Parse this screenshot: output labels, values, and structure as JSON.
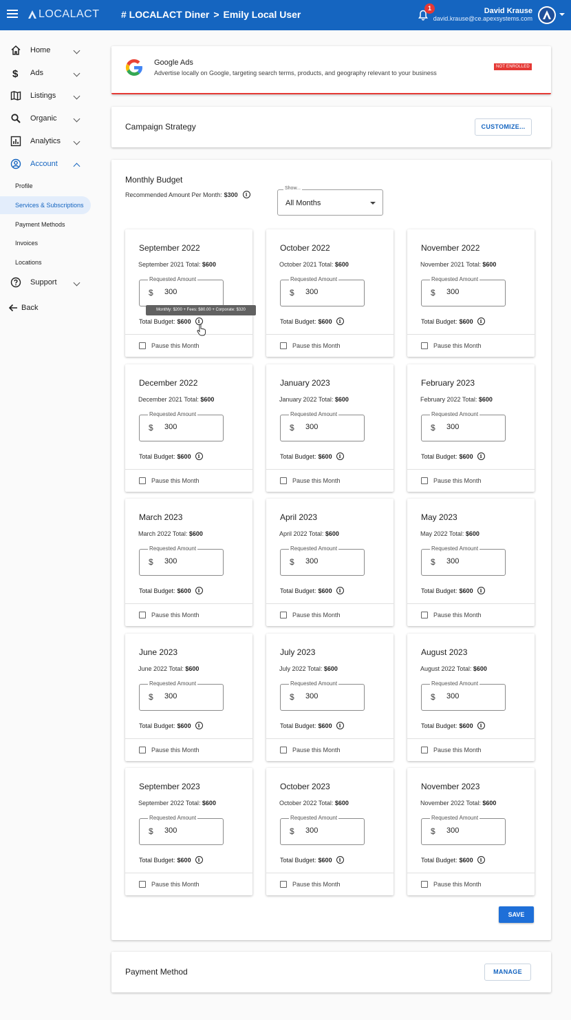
{
  "header": {
    "app_name": "LOCALACT",
    "breadcrumb_store": "# LOCALACT Diner",
    "breadcrumb_sep": ">",
    "breadcrumb_user": "Emily Local User",
    "notification_count": "1",
    "user_name": "David Krause",
    "user_email": "david.krause@ce.apexsystems.com"
  },
  "sidebar": {
    "items": [
      {
        "label": "Home",
        "icon": "home-icon"
      },
      {
        "label": "Ads",
        "icon": "dollar-icon"
      },
      {
        "label": "Listings",
        "icon": "map-icon"
      },
      {
        "label": "Organic",
        "icon": "search-icon"
      },
      {
        "label": "Analytics",
        "icon": "analytics-icon"
      },
      {
        "label": "Account",
        "icon": "account-icon"
      }
    ],
    "subitems": [
      "Profile",
      "Services & Subscriptions",
      "Payment Methods",
      "Invoices",
      "Locations"
    ],
    "support": "Support",
    "back": "Back"
  },
  "google_ads": {
    "title": "Google Ads",
    "description": "Advertise locally on Google, targeting search terms, products, and geography relevant to your business",
    "status": "NOT ENROLLED"
  },
  "campaign": {
    "title": "Campaign Strategy",
    "button": "CUSTOMIZE..."
  },
  "budget": {
    "title": "Monthly Budget",
    "recommended_label": "Recommended Amount Per Month:",
    "recommended_value": "$300",
    "show_label": "Show...",
    "show_value": "All Months",
    "field_label": "Requested Amount",
    "currency": "$",
    "total_label": "Total Budget:",
    "pause_label": "Pause this Month",
    "tooltip": "Monthly: $200 + Fees: $80.00 + Corporate: $320",
    "save_label": "SAVE",
    "months": [
      {
        "title": "September 2022",
        "prev_label": "September 2021 Total:",
        "prev_value": "$600",
        "amount": "300",
        "total": "$600"
      },
      {
        "title": "October 2022",
        "prev_label": "October 2021 Total:",
        "prev_value": "$600",
        "amount": "300",
        "total": "$600"
      },
      {
        "title": "November 2022",
        "prev_label": "November 2021 Total:",
        "prev_value": "$600",
        "amount": "300",
        "total": "$600"
      },
      {
        "title": "December 2022",
        "prev_label": "December 2021 Total:",
        "prev_value": "$600",
        "amount": "300",
        "total": "$600"
      },
      {
        "title": "January 2023",
        "prev_label": "January 2022 Total:",
        "prev_value": "$600",
        "amount": "300",
        "total": "$600"
      },
      {
        "title": "February 2023",
        "prev_label": "February 2022 Total:",
        "prev_value": "$600",
        "amount": "300",
        "total": "$600"
      },
      {
        "title": "March 2023",
        "prev_label": "March 2022 Total:",
        "prev_value": "$600",
        "amount": "300",
        "total": "$600"
      },
      {
        "title": "April 2023",
        "prev_label": "April 2022 Total:",
        "prev_value": "$600",
        "amount": "300",
        "total": "$600"
      },
      {
        "title": "May 2023",
        "prev_label": "May 2022 Total:",
        "prev_value": "$600",
        "amount": "300",
        "total": "$600"
      },
      {
        "title": "June 2023",
        "prev_label": "June 2022 Total:",
        "prev_value": "$600",
        "amount": "300",
        "total": "$600"
      },
      {
        "title": "July 2023",
        "prev_label": "July 2022 Total:",
        "prev_value": "$600",
        "amount": "300",
        "total": "$600"
      },
      {
        "title": "August 2023",
        "prev_label": "August 2022 Total:",
        "prev_value": "$600",
        "amount": "300",
        "total": "$600"
      },
      {
        "title": "September 2023",
        "prev_label": "September 2022 Total:",
        "prev_value": "$600",
        "amount": "300",
        "total": "$600"
      },
      {
        "title": "October 2023",
        "prev_label": "October 2022 Total:",
        "prev_value": "$600",
        "amount": "300",
        "total": "$600"
      },
      {
        "title": "November 2023",
        "prev_label": "November 2022 Total:",
        "prev_value": "$600",
        "amount": "300",
        "total": "$600"
      }
    ]
  },
  "payment": {
    "title": "Payment Method",
    "button": "MANAGE"
  },
  "colors": {
    "primary": "#1565c0",
    "danger": "#e53935",
    "background": "#fafafa"
  }
}
